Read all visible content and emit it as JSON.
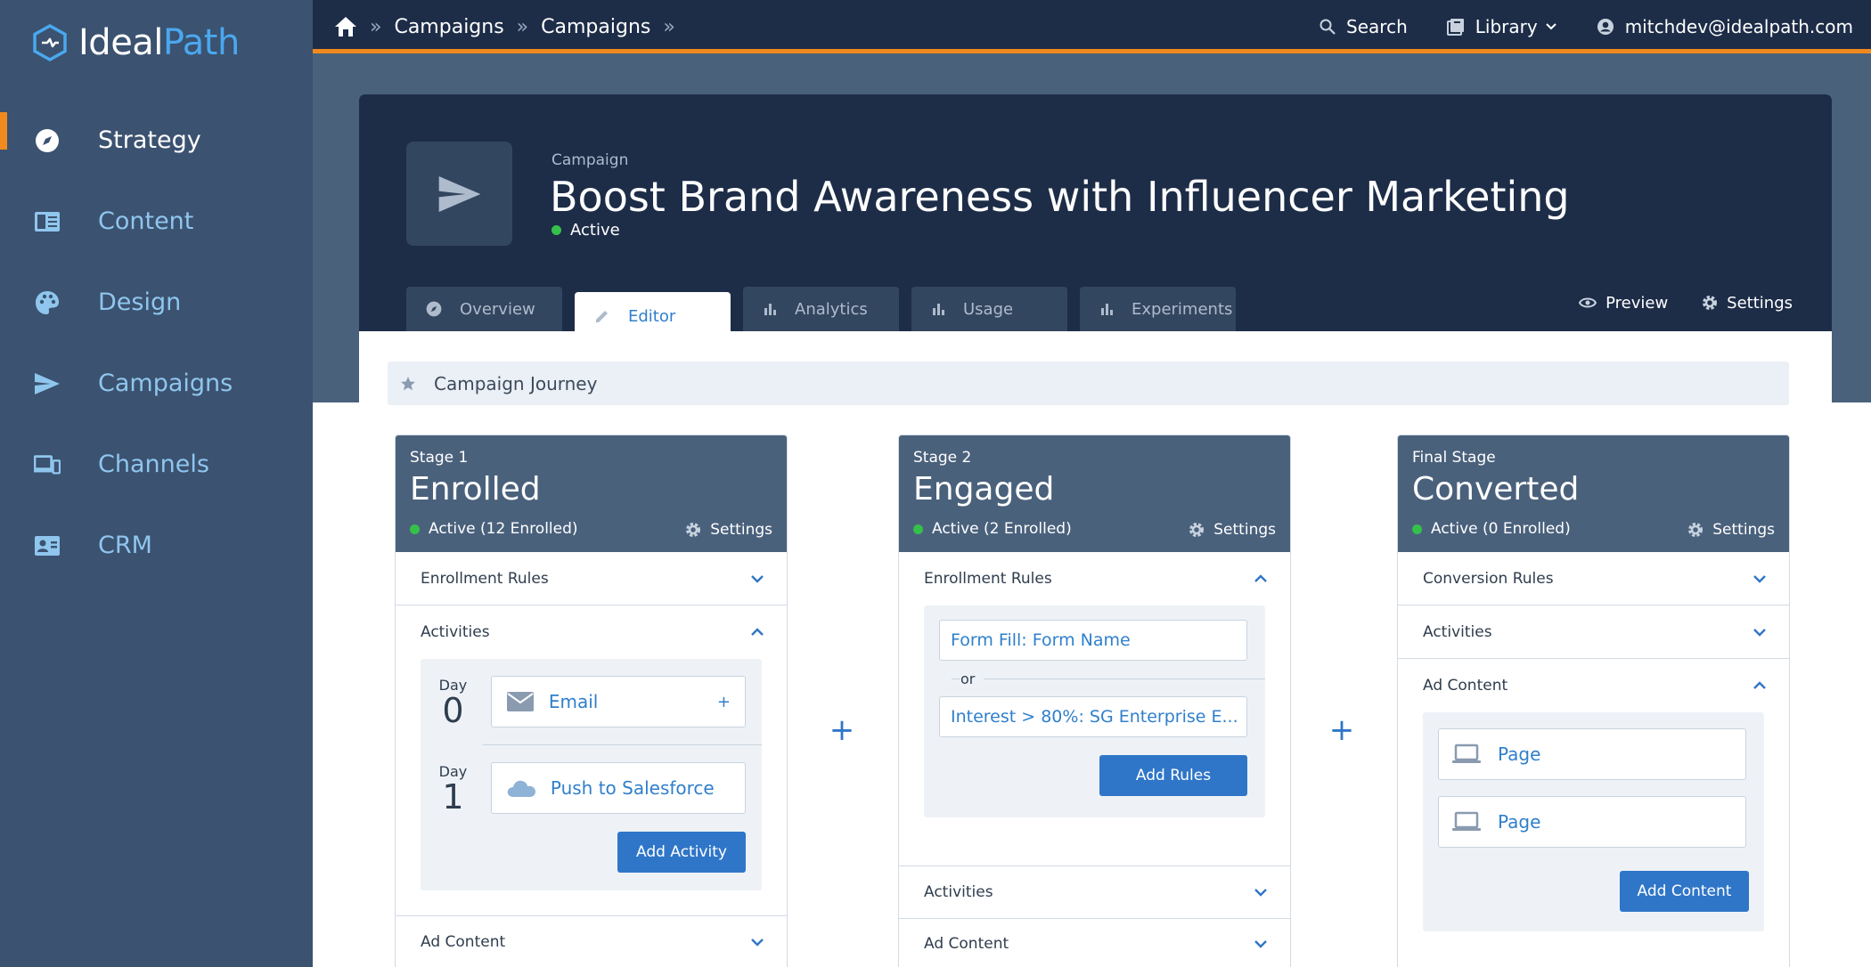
{
  "brand": {
    "name_a": "Ideal",
    "name_b": "Path",
    "accent": "#4aa8ef"
  },
  "sidebar": {
    "items": [
      {
        "label": "Strategy",
        "icon": "compass-icon",
        "active": true
      },
      {
        "label": "Content",
        "icon": "content-icon"
      },
      {
        "label": "Design",
        "icon": "palette-icon"
      },
      {
        "label": "Campaigns",
        "icon": "send-icon"
      },
      {
        "label": "Channels",
        "icon": "devices-icon"
      },
      {
        "label": "CRM",
        "icon": "contact-card-icon"
      }
    ]
  },
  "topbar": {
    "breadcrumb": [
      "Campaigns",
      "Campaigns"
    ],
    "search_label": "Search",
    "library_label": "Library",
    "user_email": "mitchdev@idealpath.com"
  },
  "campaign": {
    "kicker": "Campaign",
    "title": "Boost Brand Awareness with Influencer Marketing",
    "status": "Active",
    "tabs": [
      "Overview",
      "Editor",
      "Analytics",
      "Usage",
      "Experiments"
    ],
    "active_tab": "Editor",
    "preview_label": "Preview",
    "settings_label": "Settings"
  },
  "journey": {
    "label": "Campaign Journey"
  },
  "stages": [
    {
      "kicker": "Stage 1",
      "title": "Enrolled",
      "status": "Active (12 Enrolled)",
      "settings": "Settings",
      "sections": {
        "rules": "Enrollment Rules",
        "activities": "Activities",
        "ad_content": "Ad Content"
      },
      "activities": [
        {
          "day_label": "Day",
          "day": "0",
          "name": "Email",
          "icon": "email-icon",
          "plus": "+"
        },
        {
          "day_label": "Day",
          "day": "1",
          "name": "Push to Salesforce",
          "icon": "cloud-icon"
        }
      ],
      "add_button": "Add Activity"
    },
    {
      "kicker": "Stage 2",
      "title": "Engaged",
      "status": "Active (2 Enrolled)",
      "settings": "Settings",
      "sections": {
        "rules": "Enrollment Rules",
        "activities": "Activities",
        "ad_content": "Ad Content"
      },
      "rules": [
        "Form Fill: Form Name",
        "Interest > 80%: SG Enterprise E..."
      ],
      "or_label": "or",
      "add_button": "Add Rules"
    },
    {
      "kicker": "Final Stage",
      "title": "Converted",
      "status": "Active (0 Enrolled)",
      "settings": "Settings",
      "sections": {
        "rules": "Conversion Rules",
        "activities": "Activities",
        "ad_content": "Ad Content"
      },
      "content": [
        "Page",
        "Page"
      ],
      "add_button": "Add Content"
    }
  ],
  "add_stage_symbol": "+"
}
